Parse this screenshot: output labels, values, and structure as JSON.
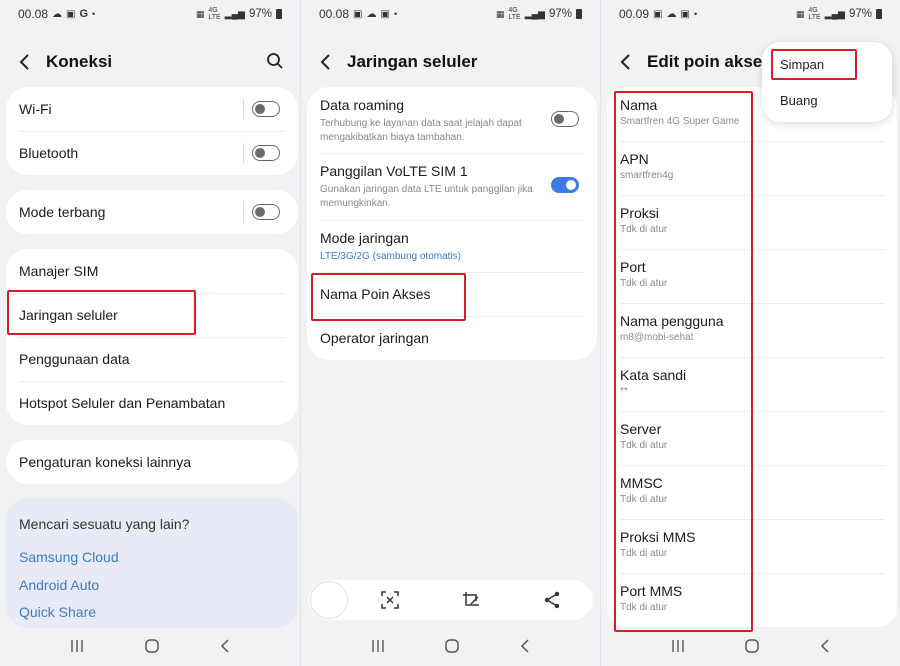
{
  "screen1": {
    "status": {
      "time": "00.08",
      "battery": "97%"
    },
    "title": "Koneksi",
    "card1": [
      "Wi-Fi",
      "Bluetooth"
    ],
    "card2": [
      "Mode terbang"
    ],
    "card3": [
      "Manajer SIM",
      "Jaringan seluler",
      "Penggunaan data",
      "Hotspot Seluler dan Penambatan"
    ],
    "card4": [
      "Pengaturan koneksi lainnya"
    ],
    "search_section": {
      "question": "Mencari sesuatu yang lain?",
      "links": [
        "Samsung Cloud",
        "Android Auto",
        "Quick Share"
      ]
    }
  },
  "screen2": {
    "status": {
      "time": "00.08",
      "battery": "97%"
    },
    "title": "Jaringan seluler",
    "items": [
      {
        "title": "Data roaming",
        "sub": "Terhubung ke layanan data saat jelajah dapat mengakibatkan biaya tambahan."
      },
      {
        "title": "Panggilan VoLTE SIM 1",
        "sub": "Gunakan jaringan data LTE untuk panggilan jika memungkinkan."
      },
      {
        "title": "Mode jaringan",
        "sub": "LTE/3G/2G (sambung otomatis)"
      },
      {
        "title": "Nama Poin Akses",
        "sub": ""
      },
      {
        "title": "Operator jaringan",
        "sub": ""
      }
    ]
  },
  "screen3": {
    "status": {
      "time": "00.09",
      "battery": "97%"
    },
    "title": "Edit poin akses",
    "menu": {
      "save": "Simpan",
      "discard": "Buang"
    },
    "fields": [
      {
        "label": "Nama",
        "value": "Smartfren 4G Super Game"
      },
      {
        "label": "APN",
        "value": "smartfren4g"
      },
      {
        "label": "Proksi",
        "value": "Tdk di atur"
      },
      {
        "label": "Port",
        "value": "Tdk di atur"
      },
      {
        "label": "Nama pengguna",
        "value": "m8@mobi-sehat"
      },
      {
        "label": "Kata sandi",
        "value": "**"
      },
      {
        "label": "Server",
        "value": "Tdk di atur"
      },
      {
        "label": "MMSC",
        "value": "Tdk di atur"
      },
      {
        "label": "Proksi MMS",
        "value": "Tdk di atur"
      },
      {
        "label": "Port MMS",
        "value": "Tdk di atur"
      }
    ]
  },
  "colors": {
    "highlight_box": "#d81f26",
    "link": "#3c7bc6",
    "toggle_on": "#3f7be8"
  }
}
